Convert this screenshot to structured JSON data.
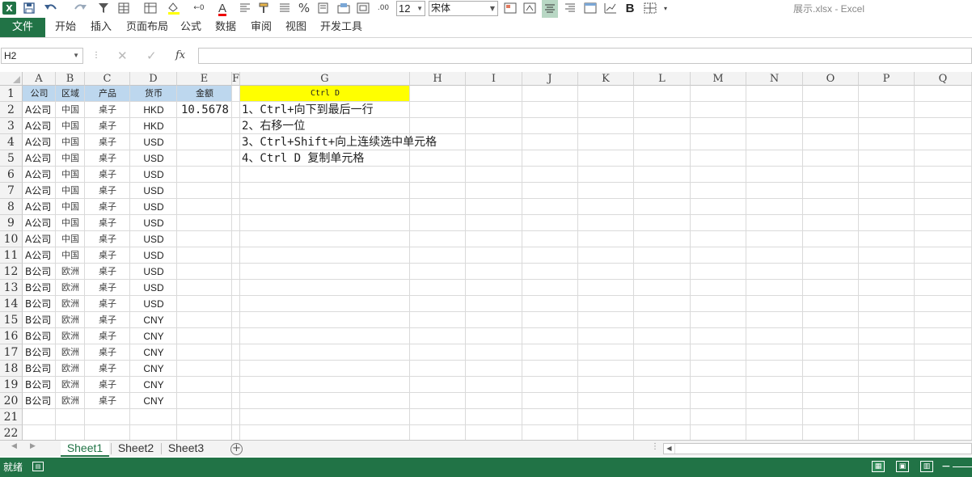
{
  "window": {
    "app_logo": "X",
    "title": "展示.xlsx - Excel"
  },
  "toolbar": {
    "font_size": "12",
    "font_name": "宋体",
    "icons": [
      "save-icon",
      "undo-icon",
      "redo-icon",
      "filter-icon",
      "insert-table-icon",
      "format-table-icon",
      "fill-color-icon",
      "decrease-decimal-icon",
      "font-color-icon",
      "align-left-icon",
      "format-painter-icon",
      "align-justify-icon",
      "percent-icon",
      "wrap-icon",
      "merge-icon",
      "grid-icon",
      "increase-decimal-icon",
      "conditional-format-icon",
      "cell-style-icon",
      "align-center-icon",
      "align-right-icon",
      "table-icon",
      "chart-icon",
      "bold-icon",
      "border-icon",
      "customize-icon"
    ],
    "percent_label": "%",
    "bold_label": "B",
    "font_color_label": "A"
  },
  "ribbon": {
    "file_label": "文件",
    "tabs": [
      "开始",
      "插入",
      "页面布局",
      "公式",
      "数据",
      "审阅",
      "视图",
      "开发工具"
    ]
  },
  "formula_bar": {
    "name_box": "H2",
    "fx_label": "fx",
    "formula": ""
  },
  "grid": {
    "columns": [
      "A",
      "B",
      "C",
      "D",
      "E",
      "F",
      "G",
      "H",
      "I",
      "J",
      "K",
      "L",
      "M",
      "N",
      "O",
      "P",
      "Q"
    ],
    "rows": [
      "1",
      "2",
      "3",
      "4",
      "5",
      "6",
      "7",
      "8",
      "9",
      "10",
      "11",
      "12",
      "13",
      "14",
      "15",
      "16",
      "17",
      "18",
      "19",
      "20",
      "21",
      "22"
    ],
    "header_row": [
      "公司",
      "区域",
      "产品",
      "货币",
      "金额"
    ],
    "data_rows": [
      [
        "A公司",
        "中国",
        "桌子",
        "HKD",
        "10.5678"
      ],
      [
        "A公司",
        "中国",
        "桌子",
        "HKD",
        ""
      ],
      [
        "A公司",
        "中国",
        "桌子",
        "USD",
        ""
      ],
      [
        "A公司",
        "中国",
        "桌子",
        "USD",
        ""
      ],
      [
        "A公司",
        "中国",
        "桌子",
        "USD",
        ""
      ],
      [
        "A公司",
        "中国",
        "桌子",
        "USD",
        ""
      ],
      [
        "A公司",
        "中国",
        "桌子",
        "USD",
        ""
      ],
      [
        "A公司",
        "中国",
        "桌子",
        "USD",
        ""
      ],
      [
        "A公司",
        "中国",
        "桌子",
        "USD",
        ""
      ],
      [
        "A公司",
        "中国",
        "桌子",
        "USD",
        ""
      ],
      [
        "B公司",
        "欧洲",
        "桌子",
        "USD",
        ""
      ],
      [
        "B公司",
        "欧洲",
        "桌子",
        "USD",
        ""
      ],
      [
        "B公司",
        "欧洲",
        "桌子",
        "USD",
        ""
      ],
      [
        "B公司",
        "欧洲",
        "桌子",
        "CNY",
        ""
      ],
      [
        "B公司",
        "欧洲",
        "桌子",
        "CNY",
        ""
      ],
      [
        "B公司",
        "欧洲",
        "桌子",
        "CNY",
        ""
      ],
      [
        "B公司",
        "欧洲",
        "桌子",
        "CNY",
        ""
      ],
      [
        "B公司",
        "欧洲",
        "桌子",
        "CNY",
        ""
      ],
      [
        "B公司",
        "欧洲",
        "桌子",
        "CNY",
        ""
      ]
    ],
    "g1_label": "Ctrl D",
    "notes": [
      "1、Ctrl+向下到最后一行",
      "2、右移一位",
      "3、Ctrl+Shift+向上连续选中单元格",
      "4、Ctrl D 复制单元格"
    ],
    "header_fill": "#bdd7ee",
    "highlight_fill": "#ffff00"
  },
  "sheets": {
    "tabs": [
      "Sheet1",
      "Sheet2",
      "Sheet3"
    ],
    "active": "Sheet1",
    "add_label": "+"
  },
  "status": {
    "ready": "就绪",
    "zoom_minus": "−"
  },
  "colors": {
    "excel_green": "#217346"
  }
}
